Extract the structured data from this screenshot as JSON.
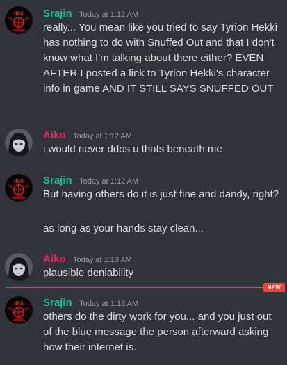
{
  "colors": {
    "background": "#313338",
    "srajin_name": "#1abc9c",
    "aiko_name": "#e91e63",
    "timestamp": "#949ba4",
    "message_text": "#dbdee1",
    "new_divider": "#f23f42"
  },
  "messages": [
    {
      "author": "Srajin",
      "timestamp": "Today at 1:12 AM",
      "avatar_icon": "red-404-logo-avatar",
      "lines": [
        "really... You mean like you tried to say Tyrion Hekki has nothing to do with Snuffed Out and that I don't know what I'm talking about there either? EVEN AFTER I posted a link to Tyrion Hekki's character info in game AND IT STILL SAYS SNUFFED OUT"
      ]
    },
    {
      "author": "Aiko",
      "timestamp": "Today at 1:12 AM",
      "avatar_icon": "dark-haired-girl-avatar",
      "lines": [
        "i would never ddos u thats beneath me"
      ]
    },
    {
      "author": "Srajin",
      "timestamp": "Today at 1:12 AM",
      "avatar_icon": "red-404-logo-avatar",
      "lines": [
        "But having others do it is just fine and dandy, right?",
        "as long as your hands stay clean..."
      ]
    },
    {
      "author": "Aiko",
      "timestamp": "Today at 1:13 AM",
      "avatar_icon": "dark-haired-girl-avatar",
      "lines": [
        "plausible deniability"
      ]
    },
    {
      "author": "Srajin",
      "timestamp": "Today at 1:13 AM",
      "avatar_icon": "red-404-logo-avatar",
      "lines": [
        "others do the dirty work for you... and you just out of the blue message the person afterward asking how their internet is."
      ]
    }
  ],
  "new_divider": {
    "label": "NEW"
  },
  "avatar_text": "404"
}
